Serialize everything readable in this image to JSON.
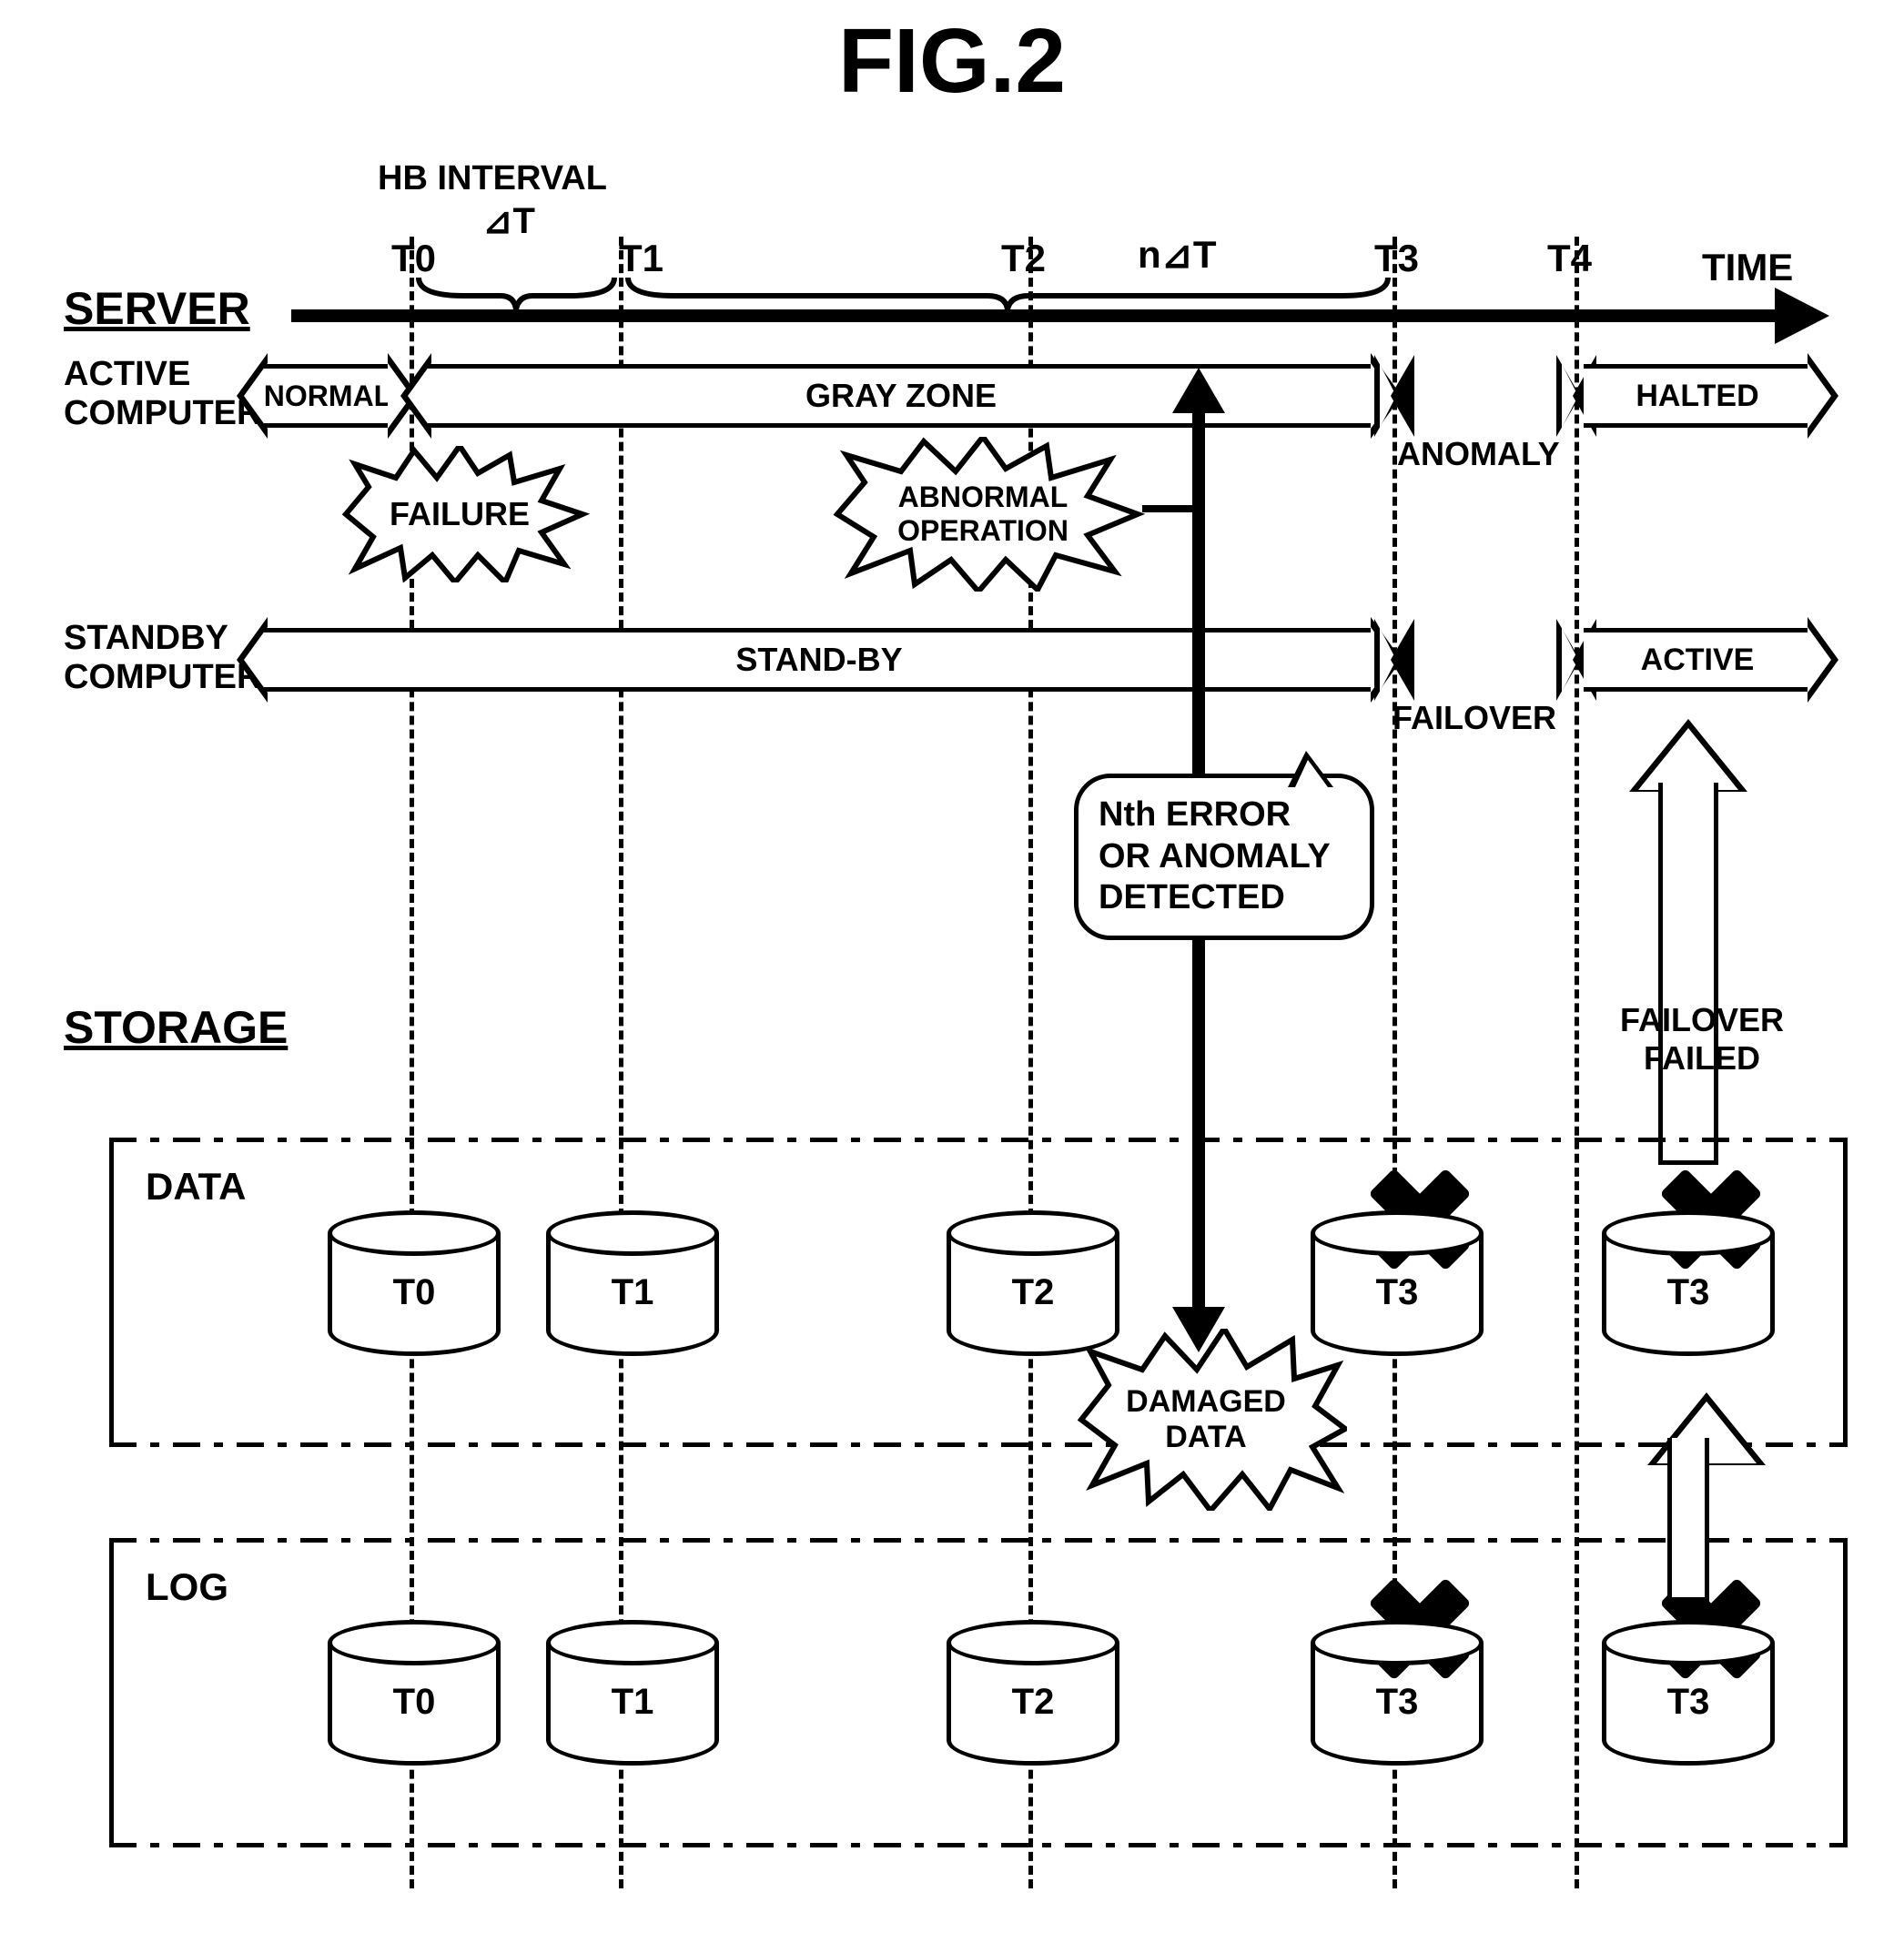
{
  "title": "FIG.2",
  "labels": {
    "time": "TIME",
    "server": "SERVER",
    "active_computer": "ACTIVE\nCOMPUTER",
    "standby_computer": "STANDBY\nCOMPUTER",
    "storage": "STORAGE",
    "hb_interval": "HB INTERVAL",
    "delta_t": "⊿T",
    "n_delta_t": "n⊿T",
    "data": "DATA",
    "log": "LOG",
    "failover_failed": "FAILOVER\nFAILED"
  },
  "timepoints": [
    "T0",
    "T1",
    "T2",
    "T3",
    "T4"
  ],
  "active_row": {
    "normal": "NORMAL",
    "gray_zone": "GRAY ZONE",
    "anomaly": "ANOMALY",
    "halted": "HALTED"
  },
  "standby_row": {
    "standby": "STAND-BY",
    "failover": "FAILOVER",
    "active": "ACTIVE"
  },
  "bursts": {
    "failure": "FAILURE",
    "abnormal": "ABNORMAL\nOPERATION",
    "damaged": "DAMAGED\nDATA"
  },
  "callout": "Nth ERROR\nOR ANOMALY\nDETECTED",
  "data_cyls": [
    "T0",
    "T1",
    "T2",
    "T3",
    "T3"
  ],
  "log_cyls": [
    "T0",
    "T1",
    "T2",
    "T3",
    "T3"
  ],
  "chart_data": {
    "type": "timeline",
    "axis": "TIME",
    "ticks": [
      "T0",
      "T1",
      "T2",
      "T3",
      "T4"
    ],
    "intervals": [
      {
        "name": "HB INTERVAL ⊿T",
        "from": "T0",
        "to": "T1"
      },
      {
        "name": "n⊿T",
        "from": "T1",
        "to": "T3"
      }
    ],
    "rows": [
      {
        "name": "ACTIVE COMPUTER",
        "segments": [
          {
            "label": "NORMAL",
            "from": "start",
            "to": "T0"
          },
          {
            "label": "GRAY ZONE",
            "from": "T0",
            "to": "T3"
          },
          {
            "label": "ANOMALY",
            "from": "T3",
            "to": "T4"
          },
          {
            "label": "HALTED",
            "from": "T4",
            "to": "end"
          }
        ],
        "events": [
          {
            "label": "FAILURE",
            "at": "T0"
          },
          {
            "label": "ABNORMAL OPERATION",
            "at": "T2"
          }
        ]
      },
      {
        "name": "STANDBY COMPUTER",
        "segments": [
          {
            "label": "STAND-BY",
            "from": "start",
            "to": "T3"
          },
          {
            "label": "FAILOVER",
            "from": "T3",
            "to": "T4"
          },
          {
            "label": "ACTIVE",
            "from": "T4",
            "to": "end"
          }
        ],
        "events": [
          {
            "label": "Nth ERROR OR ANOMALY DETECTED",
            "at": "T3"
          }
        ]
      }
    ],
    "storage": {
      "DATA": [
        {
          "label": "T0",
          "damaged": false
        },
        {
          "label": "T1",
          "damaged": false
        },
        {
          "label": "T2",
          "damaged": false
        },
        {
          "label": "T3",
          "damaged": true
        },
        {
          "label": "T3",
          "damaged": true
        }
      ],
      "LOG": [
        {
          "label": "T0",
          "damaged": false
        },
        {
          "label": "T1",
          "damaged": false
        },
        {
          "label": "T2",
          "damaged": false
        },
        {
          "label": "T3",
          "damaged": true
        },
        {
          "label": "T3",
          "damaged": true
        }
      ],
      "burst": "DAMAGED DATA",
      "result": "FAILOVER FAILED"
    }
  }
}
